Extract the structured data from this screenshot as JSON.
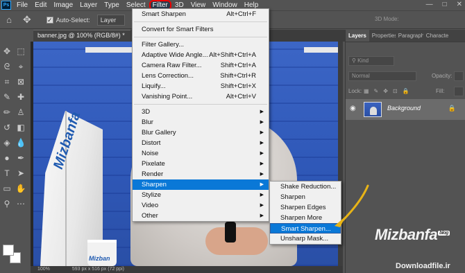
{
  "menubar": {
    "logo": "Ps",
    "items": [
      "File",
      "Edit",
      "Image",
      "Layer",
      "Type",
      "Select",
      "Filter",
      "3D",
      "View",
      "Window",
      "Help"
    ],
    "active": "Filter",
    "window_controls": [
      "—",
      "□",
      "✕"
    ]
  },
  "options": {
    "auto_select_label": "Auto-Select:",
    "auto_select_checked": true,
    "target_value": "Layer",
    "mode_3d": "3D Mode:"
  },
  "document": {
    "tab_label": "banner.jpg @ 100% (RGB/8#) *",
    "close": "×",
    "zoom": "100%",
    "dimensions": "593 px x 516 px (72 ppi)"
  },
  "filter_menu": {
    "items": [
      {
        "label": "Smart Sharpen",
        "shortcut": "Alt+Ctrl+F"
      },
      {
        "sep": true
      },
      {
        "label": "Convert for Smart Filters"
      },
      {
        "sep": true
      },
      {
        "label": "Filter Gallery..."
      },
      {
        "label": "Adaptive Wide Angle...",
        "shortcut": "Alt+Shift+Ctrl+A"
      },
      {
        "label": "Camera Raw Filter...",
        "shortcut": "Shift+Ctrl+A"
      },
      {
        "label": "Lens Correction...",
        "shortcut": "Shift+Ctrl+R"
      },
      {
        "label": "Liquify...",
        "shortcut": "Shift+Ctrl+X"
      },
      {
        "label": "Vanishing Point...",
        "shortcut": "Alt+Ctrl+V"
      },
      {
        "sep": true
      },
      {
        "label": "3D",
        "submenu": true
      },
      {
        "label": "Blur",
        "submenu": true
      },
      {
        "label": "Blur Gallery",
        "submenu": true
      },
      {
        "label": "Distort",
        "submenu": true
      },
      {
        "label": "Noise",
        "submenu": true
      },
      {
        "label": "Pixelate",
        "submenu": true
      },
      {
        "label": "Render",
        "submenu": true
      },
      {
        "label": "Sharpen",
        "submenu": true,
        "highlighted": true
      },
      {
        "label": "Stylize",
        "submenu": true
      },
      {
        "label": "Video",
        "submenu": true
      },
      {
        "label": "Other",
        "submenu": true
      }
    ]
  },
  "sharpen_menu": {
    "items": [
      {
        "label": "Shake Reduction..."
      },
      {
        "label": "Sharpen"
      },
      {
        "label": "Sharpen Edges"
      },
      {
        "label": "Sharpen More"
      },
      {
        "label": "Smart Sharpen...",
        "highlighted": true
      },
      {
        "label": "Unsharp Mask..."
      }
    ]
  },
  "layers_panel": {
    "tabs": [
      "Layers",
      "Properties",
      "Paragraph",
      "Characte"
    ],
    "active_tab": "Layers",
    "kind_placeholder": "Kind",
    "blend_mode": "Normal",
    "opacity_label": "Opacity:",
    "lock_label": "Lock:",
    "fill_label": "Fill:",
    "layer_name": "Background"
  },
  "watermark": {
    "brand": "Mizbanfa",
    "badge": "blog",
    "download_text": "Downloadfile.ir"
  },
  "photo": {
    "flag_text": "Mizbanfa",
    "mug_text": "Mizban"
  },
  "colors": {
    "menu_highlight": "#0a78d7",
    "annotation_circle": "#e00000",
    "annotation_arrow": "#e8b417"
  }
}
